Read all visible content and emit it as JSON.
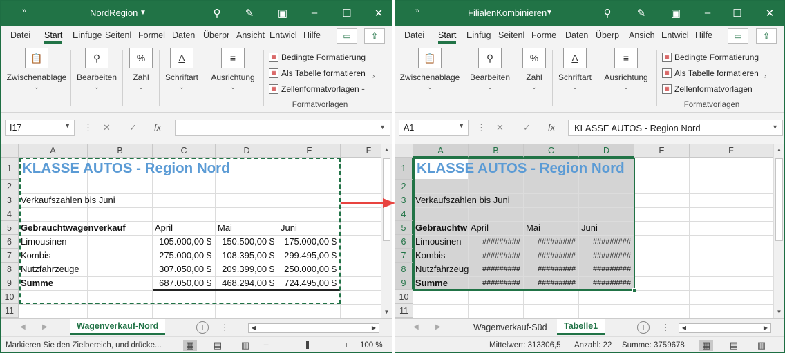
{
  "windows": [
    {
      "title": "NordRegion",
      "ribbon_tabs": [
        "Datei",
        "Start",
        "Einfüge",
        "Seitenl",
        "Formel",
        "Daten",
        "Überpr",
        "Ansicht",
        "Entwicl",
        "Hilfe"
      ],
      "ribbon_groups": [
        "Zwischenablage",
        "Bearbeiten",
        "Zahl",
        "Schriftart",
        "Ausrichtung"
      ],
      "format_items": [
        "Bedingte Formatierung",
        "Als Tabelle formatieren",
        "Zellenformatvorlagen"
      ],
      "format_group": "Formatvorlagen",
      "name_box": "I17",
      "formula": "",
      "columns": [
        "A",
        "B",
        "C",
        "D",
        "E",
        "F"
      ],
      "rows": [
        "1",
        "2",
        "3",
        "4",
        "5",
        "6",
        "7",
        "8",
        "9",
        "10",
        "11"
      ],
      "cells": {
        "title": "KLASSE AUTOS - Region Nord",
        "subtitle": "Verkaufszahlen bis Juni",
        "header": [
          "Gebrauchtwagenverkauf",
          "April",
          "Mai",
          "Juni"
        ],
        "data": [
          [
            "Limousinen",
            "105.000,00 $",
            "150.500,00 $",
            "175.000,00 $"
          ],
          [
            "Kombis",
            "275.000,00 $",
            "108.395,00 $",
            "299.495,00 $"
          ],
          [
            "Nutzfahrzeuge",
            "307.050,00 $",
            "209.399,00 $",
            "250.000,00 $"
          ],
          [
            "Summe",
            "687.050,00 $",
            "468.294,00 $",
            "724.495,00 $"
          ]
        ]
      },
      "sheet_tabs": [
        "Wagenverkauf-Nord"
      ],
      "active_tab": "Wagenverkauf-Nord",
      "status": "Markieren Sie den Zielbereich, und drücke...",
      "zoom": "100 %"
    },
    {
      "title": "FilialenKombinieren",
      "ribbon_tabs": [
        "Datei",
        "Start",
        "Einfüg",
        "Seitenl",
        "Forme",
        "Daten",
        "Überp",
        "Ansich",
        "Entwicl",
        "Hilfe"
      ],
      "ribbon_groups": [
        "Zwischenablage",
        "Bearbeiten",
        "Zahl",
        "Schriftart",
        "Ausrichtung"
      ],
      "format_items": [
        "Bedingte Formatierung",
        "Als Tabelle formatieren",
        "Zellenformatvorlagen"
      ],
      "format_group": "Formatvorlagen",
      "name_box": "A1",
      "formula": "KLASSE AUTOS - Region Nord",
      "columns": [
        "A",
        "B",
        "C",
        "D",
        "E",
        "F"
      ],
      "rows": [
        "1",
        "2",
        "3",
        "4",
        "5",
        "6",
        "7",
        "8",
        "9",
        "10",
        "11"
      ],
      "cells": {
        "title": "KLASSE AUTOS - Region Nord",
        "subtitle": "Verkaufszahlen bis Juni",
        "header": [
          "Gebrauchtw",
          "April",
          "Mai",
          "Juni"
        ],
        "data": [
          [
            "Limousinen",
            "#########",
            "#########",
            "#########"
          ],
          [
            "Kombis",
            "#########",
            "#########",
            "#########"
          ],
          [
            "Nutzfahrzeug",
            "#########",
            "#########",
            "#########"
          ],
          [
            "Summe",
            "#########",
            "#########",
            "#########"
          ]
        ]
      },
      "sheet_tabs": [
        "Wagenverkauf-Süd",
        "Tabelle1"
      ],
      "active_tab": "Tabelle1",
      "status_mittelwert": "Mittelwert: 313306,5",
      "status_anzahl": "Anzahl: 22",
      "status_summe": "Summe: 3759678"
    }
  ],
  "colors": {
    "excel_green": "#217346",
    "title_blue": "#5b9bd5",
    "selection_gray": "#d4d4d4",
    "arrow_red": "#e8433f"
  },
  "icons": [
    "expand-icon",
    "search-icon",
    "pen-icon",
    "restore-icon",
    "minimize-icon",
    "maximize-icon",
    "close-icon",
    "comment-icon",
    "share-icon"
  ]
}
